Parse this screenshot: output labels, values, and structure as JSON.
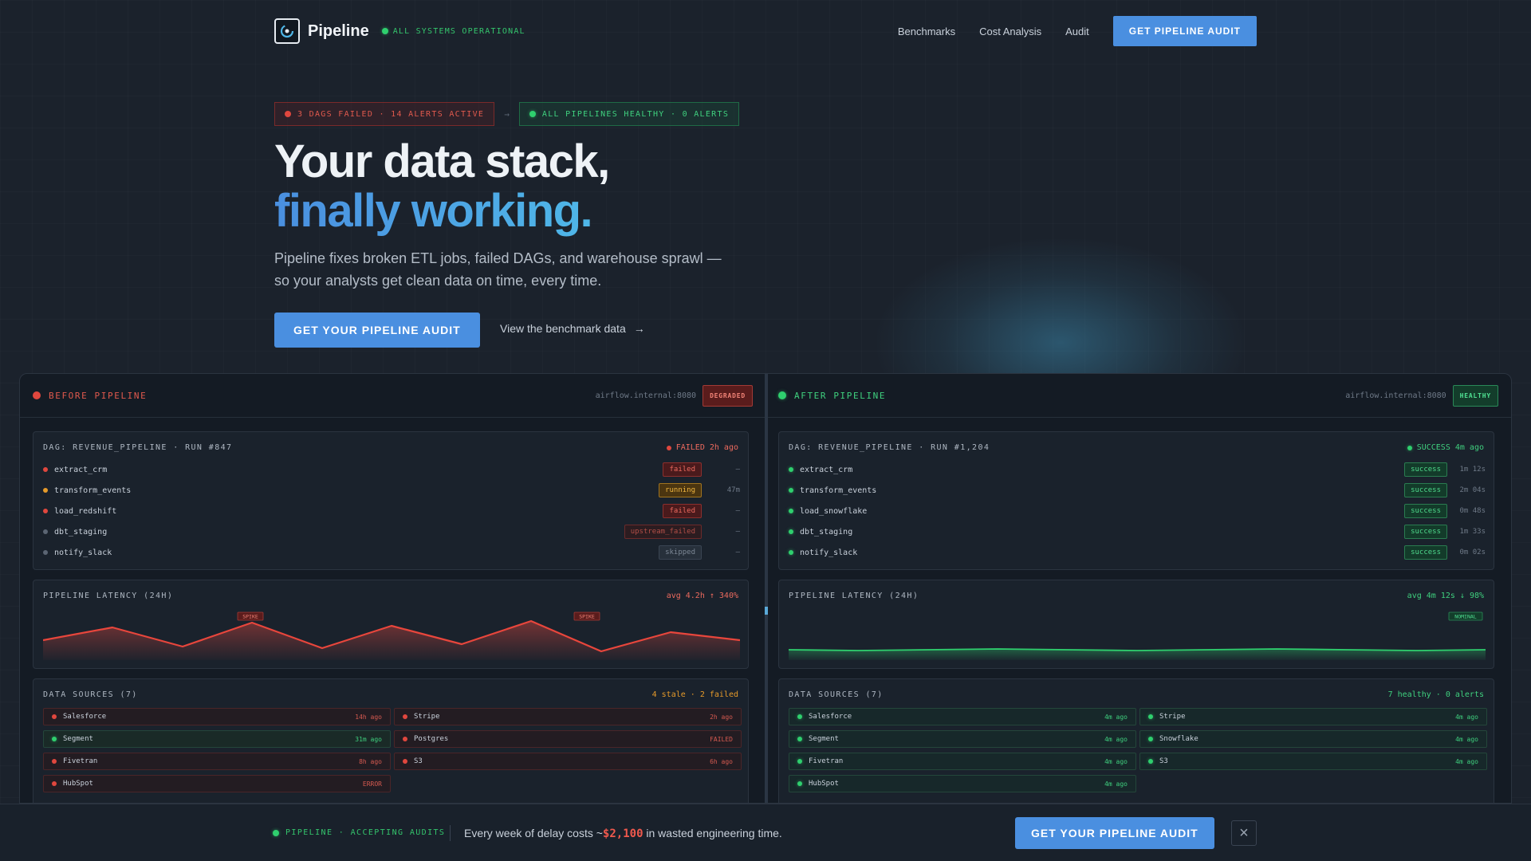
{
  "nav": {
    "brand": "Pipeline",
    "status": "ALL SYSTEMS OPERATIONAL",
    "links": [
      "Benchmarks",
      "Cost Analysis",
      "Audit"
    ],
    "cta": "GET PIPELINE AUDIT"
  },
  "hero": {
    "alert_bad": "3 DAGS FAILED · 14 ALERTS ACTIVE",
    "alert_sep": "→",
    "alert_good": "ALL PIPELINES HEALTHY · 0 ALERTS",
    "title_line1": "Your data stack,",
    "title_line2": "finally working.",
    "subtitle": "Pipeline fixes broken ETL jobs, failed DAGs, and warehouse sprawl — so your analysts get clean data on time, every time.",
    "cta": "GET YOUR PIPELINE AUDIT",
    "link": "View the benchmark data",
    "link_arrow": "→"
  },
  "before": {
    "label": "BEFORE PIPELINE",
    "host": "airflow.internal:8080",
    "badge": "DEGRADED",
    "dag_title": "DAG: REVENUE_PIPELINE · RUN #847",
    "dag_status": "FAILED 2h ago",
    "tasks": [
      {
        "name": "extract_crm",
        "status": "failed",
        "dur": "—",
        "dot": "red",
        "cls": "failed"
      },
      {
        "name": "transform_events",
        "status": "running",
        "dur": "47m",
        "dot": "orange",
        "cls": "running"
      },
      {
        "name": "load_redshift",
        "status": "failed",
        "dur": "—",
        "dot": "red",
        "cls": "failed"
      },
      {
        "name": "dbt_staging",
        "status": "upstream_failed",
        "dur": "—",
        "dot": "gray",
        "cls": "upstream"
      },
      {
        "name": "notify_slack",
        "status": "skipped",
        "dur": "—",
        "dot": "gray",
        "cls": "skipped"
      }
    ],
    "latency_title": "PIPELINE LATENCY (24H)",
    "latency_meta": "avg 4.2h ↑ 340%",
    "spike_label": "SPIKE",
    "sources_title": "DATA SOURCES (7)",
    "sources_meta": "4 stale · 2 failed",
    "sources": [
      {
        "name": "Salesforce",
        "ago": "14h ago",
        "dot": "red",
        "cls": "bad"
      },
      {
        "name": "Stripe",
        "ago": "2h ago",
        "dot": "red",
        "cls": "bad"
      },
      {
        "name": "Segment",
        "ago": "31m ago",
        "dot": "green",
        "cls": "okb"
      },
      {
        "name": "Postgres",
        "ago": "FAILED",
        "dot": "red",
        "cls": "bad"
      },
      {
        "name": "Fivetran",
        "ago": "8h ago",
        "dot": "red",
        "cls": "bad"
      },
      {
        "name": "S3",
        "ago": "6h ago",
        "dot": "red",
        "cls": "bad"
      },
      {
        "name": "HubSpot",
        "ago": "ERROR",
        "dot": "red",
        "cls": "bad"
      }
    ]
  },
  "after": {
    "label": "AFTER PIPELINE",
    "host": "airflow.internal:8080",
    "badge": "HEALTHY",
    "dag_title": "DAG: REVENUE_PIPELINE · RUN #1,204",
    "dag_status": "SUCCESS 4m ago",
    "tasks": [
      {
        "name": "extract_crm",
        "status": "success",
        "dur": "1m 12s",
        "dot": "green",
        "cls": "success"
      },
      {
        "name": "transform_events",
        "status": "success",
        "dur": "2m 04s",
        "dot": "green",
        "cls": "success"
      },
      {
        "name": "load_snowflake",
        "status": "success",
        "dur": "0m 48s",
        "dot": "green",
        "cls": "success"
      },
      {
        "name": "dbt_staging",
        "status": "success",
        "dur": "1m 33s",
        "dot": "green",
        "cls": "success"
      },
      {
        "name": "notify_slack",
        "status": "success",
        "dur": "0m 02s",
        "dot": "green",
        "cls": "success"
      }
    ],
    "latency_title": "PIPELINE LATENCY (24H)",
    "latency_meta": "avg 4m 12s ↓ 98%",
    "nominal_label": "NOMINAL",
    "sources_title": "DATA SOURCES (7)",
    "sources_meta": "7 healthy · 0 alerts",
    "sources": [
      {
        "name": "Salesforce",
        "ago": "4m ago",
        "dot": "green",
        "cls": "good"
      },
      {
        "name": "Stripe",
        "ago": "4m ago",
        "dot": "green",
        "cls": "good"
      },
      {
        "name": "Segment",
        "ago": "4m ago",
        "dot": "green",
        "cls": "good"
      },
      {
        "name": "Snowflake",
        "ago": "4m ago",
        "dot": "green",
        "cls": "good"
      },
      {
        "name": "Fivetran",
        "ago": "4m ago",
        "dot": "green",
        "cls": "good"
      },
      {
        "name": "S3",
        "ago": "4m ago",
        "dot": "green",
        "cls": "good"
      },
      {
        "name": "HubSpot",
        "ago": "4m ago",
        "dot": "green",
        "cls": "good"
      }
    ]
  },
  "sticky": {
    "status": "PIPELINE · ACCEPTING AUDITS",
    "msg_before": "Every week of delay costs ~",
    "cost": "$2,100",
    "msg_after": " in wasted engineering time.",
    "cta": "GET YOUR PIPELINE AUDIT",
    "close": "×"
  },
  "colors": {
    "accent": "#4a8fe0",
    "success": "#2fcf6e",
    "danger": "#e0473e",
    "warning": "#e59a2a"
  },
  "icons": {
    "logo": "pipeline-logo-icon",
    "arrow": "arrow-right-icon",
    "close": "close-icon"
  }
}
